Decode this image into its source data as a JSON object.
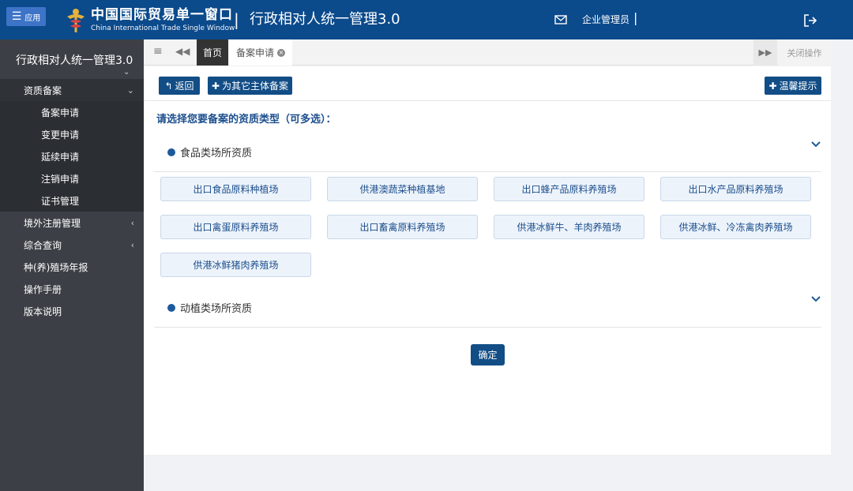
{
  "header": {
    "app_button_label": "应用",
    "brand_cn": "中国国际贸易单一窗口",
    "brand_en": "China International Trade Single Window",
    "separator": "|",
    "system_title": "行政相对人统一管理3.0",
    "user_label": "企业管理员",
    "user_separator": "|"
  },
  "sidebar": {
    "title": "行政相对人统一管理3.0",
    "groups": [
      {
        "label": "资质备案",
        "expanded": true
      },
      {
        "label": "境外注册管理"
      },
      {
        "label": "综合查询"
      },
      {
        "label": "种(养)殖场年报"
      },
      {
        "label": "操作手册"
      },
      {
        "label": "版本说明"
      }
    ],
    "subitems": [
      "备案申请",
      "变更申请",
      "延续申请",
      "注销申请",
      "证书管理"
    ]
  },
  "tabs": {
    "home": "首页",
    "active": "备案申请",
    "close_ops": "关闭操作"
  },
  "toolbar": {
    "back": "返回",
    "other_entity": "为其它主体备案",
    "tips": "温馨提示"
  },
  "instruction": "请选择您要备案的资质类型（可多选）：",
  "sections": [
    {
      "title": "食品类场所资质",
      "items": [
        "出口食品原料种植场",
        "供港澳蔬菜种植基地",
        "出口蜂产品原料养殖场",
        "出口水产品原料养殖场",
        "出口禽蛋原料养殖场",
        "出口畜禽原料养殖场",
        "供港冰鲜牛、羊肉养殖场",
        "供港冰鲜、冷冻禽肉养殖场",
        "供港冰鲜猪肉养殖场"
      ]
    },
    {
      "title": "动植类场所资质",
      "items": []
    }
  ],
  "confirm_label": "确定",
  "colors": {
    "header_bg": "#0b4a8b",
    "sidebar_bg": "#3c4046",
    "primary_button": "#124d86",
    "option_bg": "#edf3fa",
    "instruction_text": "#1c4f8e"
  }
}
